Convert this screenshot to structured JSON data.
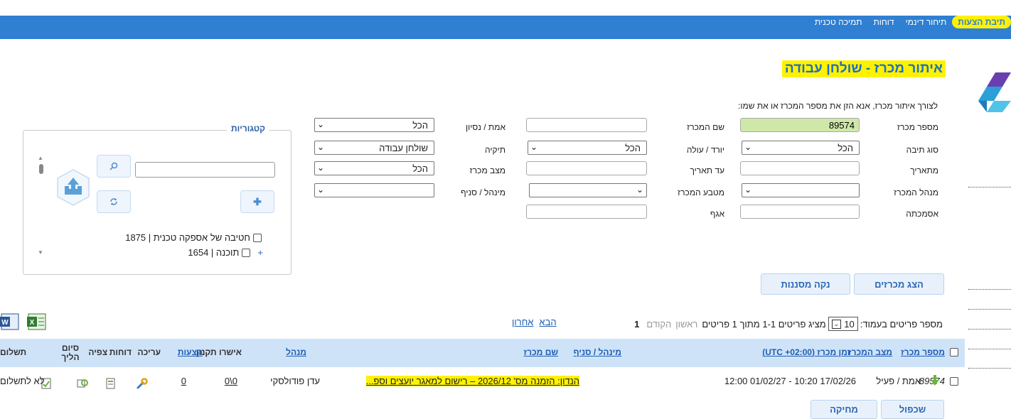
{
  "nav": {
    "items": [
      {
        "label": "תיבת הצעות",
        "active": true
      },
      {
        "label": "תיחור דינמי",
        "active": false
      },
      {
        "label": "דוחות",
        "active": false
      },
      {
        "label": "תמיכה טכנית",
        "active": false
      }
    ]
  },
  "page": {
    "title": "איתור מכרז - שולחן עבודה",
    "instruction": "לצורך איתור מכרז, אנא הזן את מספר המכרז או את שמו:"
  },
  "form": {
    "tender_number": {
      "label": "מספר מכרז",
      "value": "89574"
    },
    "box_type": {
      "label": "סוג תיבה",
      "value": "הכל"
    },
    "from_date": {
      "label": "מתאריך",
      "value": ""
    },
    "tender_manager": {
      "label": "מנהל המכרז",
      "value": ""
    },
    "reference": {
      "label": "אסמכתה",
      "value": ""
    },
    "tender_name": {
      "label": "שם המכרז",
      "value": ""
    },
    "up_down": {
      "label": "יורד / עולה",
      "value": "הכל"
    },
    "to_date": {
      "label": "עד תאריך",
      "value": ""
    },
    "currency": {
      "label": "מטבע המכרז",
      "value": ""
    },
    "department": {
      "label": "אגף",
      "value": ""
    },
    "real_test": {
      "label": "אמת / נסיון",
      "value": "הכל"
    },
    "folder": {
      "label": "תיקיה",
      "value": "שולחן עבודה"
    },
    "tender_status": {
      "label": "מצב מכרז",
      "value": "הכל"
    },
    "manager_branch": {
      "label": "מינהל / סניף",
      "value": ""
    }
  },
  "categories": {
    "legend": "קטגוריות",
    "search_value": "",
    "items": [
      {
        "label": "חטיבה של אספקה טכנית | 1875"
      },
      {
        "label": "תוכנה | 1654"
      }
    ],
    "expand": "+"
  },
  "buttons": {
    "show_tenders": "הצג מכרזים",
    "clear_filters": "נקה מסננות",
    "duplicate": "שכפול",
    "delete": "מחיקה"
  },
  "pager": {
    "per_page_label": "מספר פריטים בעמוד:",
    "per_page_value": "10",
    "showing": "מציג פריטים 1-1 מתוך 1 פריטים",
    "first": "ראשון",
    "prev": "הקודם",
    "current": "1",
    "next": "הבא",
    "last": "אחרון"
  },
  "table": {
    "headers": {
      "tender_no": "מספר מכרז",
      "status": "מצב המכרז",
      "time": "זמן מכרז (UTC +02:00)",
      "manager_branch": "מינהל / סניף",
      "tender_name": "שם מכרז",
      "manager": "מנהל",
      "standard_approval": "אישרו תקנון",
      "offers": "הצעות",
      "edit": "עריכה",
      "reports": "דוחות",
      "view": "צפיה",
      "process_end": "סיום הליך",
      "payment": "תשלום"
    },
    "rows": [
      {
        "tender_no": "89574",
        "status": "אמת / פעיל",
        "time": "17/02/26 10:20 - 01/02/27 12:00",
        "tender_name": "הנדון: הזמנה מס' 2026/12 – רישום למאגר יועצים וספ...",
        "manager": "עדן פודולסקי",
        "standard_approval": "0\\0",
        "offers": "0",
        "payment": "לא לתשלום"
      }
    ]
  }
}
